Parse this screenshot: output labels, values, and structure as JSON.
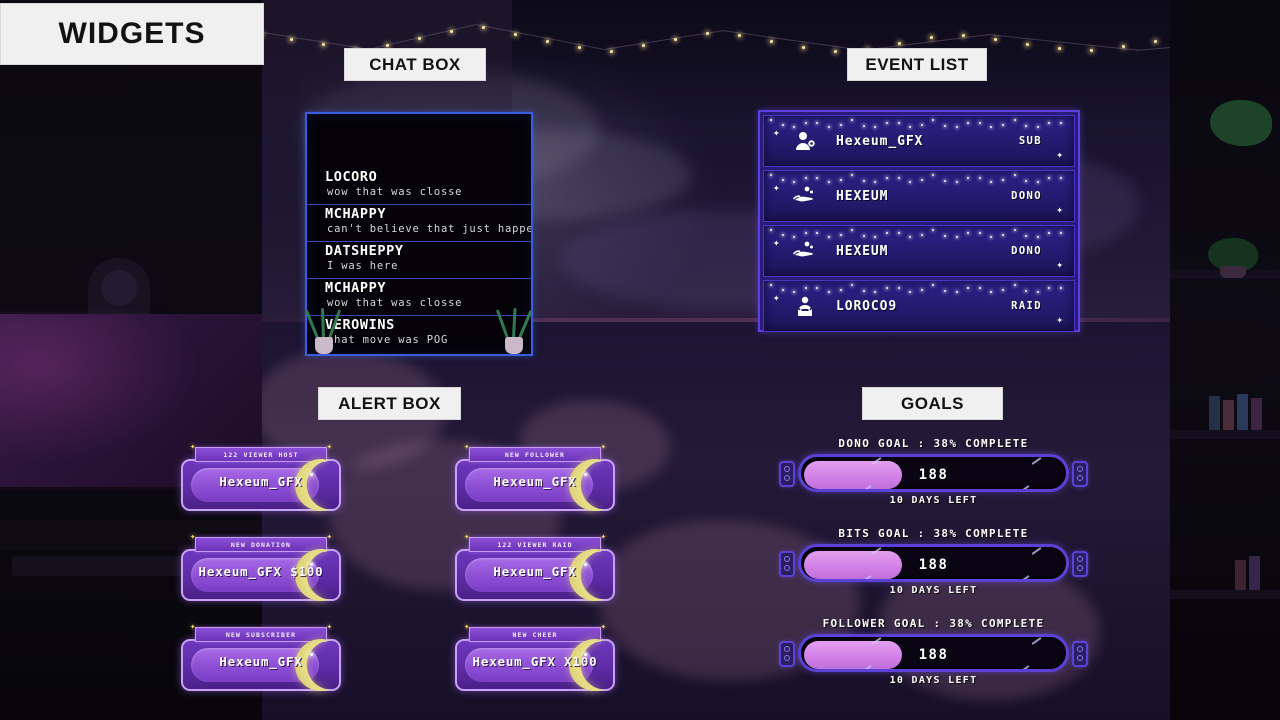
{
  "labels": {
    "widgets": "WIDGETS",
    "chat_box": "CHAT BOX",
    "event_list": "EVENT LIST",
    "alert_box": "ALERT BOX",
    "goals": "GOALS"
  },
  "chat": {
    "messages": [
      {
        "user": "LOCORO",
        "text": "wow that was closse"
      },
      {
        "user": "MCHAPPY",
        "text": "can't believe that just happened"
      },
      {
        "user": "DATSHEPPY",
        "text": "I was here"
      },
      {
        "user": "MCHAPPY",
        "text": "wow that was closse"
      },
      {
        "user": "VEROWINS",
        "text": "that move was POG"
      }
    ]
  },
  "events": [
    {
      "icon": "sub-person-icon",
      "name": "Hexeum_GFX",
      "type": "SUB"
    },
    {
      "icon": "donation-hand-icon",
      "name": "HEXEUM",
      "type": "DONO"
    },
    {
      "icon": "donation-hand-icon",
      "name": "HEXEUM",
      "type": "DONO"
    },
    {
      "icon": "raid-crown-icon",
      "name": "LOROCO9",
      "type": "RAID"
    }
  ],
  "alerts": [
    {
      "title": "122 VIEWER HOST",
      "text": "Hexeum_GFX"
    },
    {
      "title": "NEW FOLLOWER",
      "text": "Hexeum_GFX"
    },
    {
      "title": "NEW DONATION",
      "text": "Hexeum_GFX $100"
    },
    {
      "title": "122 VIEWER RAID",
      "text": "Hexeum_GFX"
    },
    {
      "title": "NEW SUBSCRIBER",
      "text": "Hexeum_GFX"
    },
    {
      "title": "NEW CHEER",
      "text": "Hexeum_GFX X100"
    }
  ],
  "goals": [
    {
      "title": "DONO GOAL : 38% COMPLETE",
      "value": "188",
      "sub": "10 DAYS LEFT",
      "percent": 38
    },
    {
      "title": "BITS GOAL : 38% COMPLETE",
      "value": "188",
      "sub": "10 DAYS LEFT",
      "percent": 38
    },
    {
      "title": "FOLLOWER GOAL : 38% COMPLETE",
      "value": "188",
      "sub": "10 DAYS LEFT",
      "percent": 38
    }
  ],
  "colors": {
    "label_bg": "#f0f0f0",
    "chat_border": "#3a5ddb",
    "event_border": "#5b3fe0",
    "alert_purple": "#8c4fd4",
    "goal_fill": "#d282e6",
    "moon_yellow": "#e8e08a"
  }
}
